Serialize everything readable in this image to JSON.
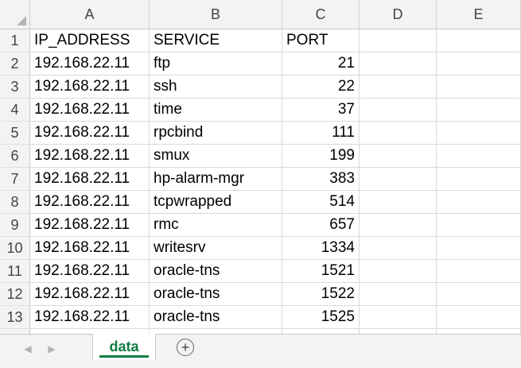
{
  "columns": [
    "A",
    "B",
    "C",
    "D",
    "E"
  ],
  "rows": [
    {
      "num": "1",
      "cells": [
        "IP_ADDRESS",
        "SERVICE",
        "PORT",
        "",
        ""
      ]
    },
    {
      "num": "2",
      "cells": [
        "192.168.22.11",
        "ftp",
        "21",
        "",
        ""
      ]
    },
    {
      "num": "3",
      "cells": [
        "192.168.22.11",
        "ssh",
        "22",
        "",
        ""
      ]
    },
    {
      "num": "4",
      "cells": [
        "192.168.22.11",
        "time",
        "37",
        "",
        ""
      ]
    },
    {
      "num": "5",
      "cells": [
        "192.168.22.11",
        "rpcbind",
        "111",
        "",
        ""
      ]
    },
    {
      "num": "6",
      "cells": [
        "192.168.22.11",
        "smux",
        "199",
        "",
        ""
      ]
    },
    {
      "num": "7",
      "cells": [
        "192.168.22.11",
        "hp-alarm-mgr",
        "383",
        "",
        ""
      ]
    },
    {
      "num": "8",
      "cells": [
        "192.168.22.11",
        "tcpwrapped",
        "514",
        "",
        ""
      ]
    },
    {
      "num": "9",
      "cells": [
        "192.168.22.11",
        "rmc",
        "657",
        "",
        ""
      ]
    },
    {
      "num": "10",
      "cells": [
        "192.168.22.11",
        "writesrv",
        "1334",
        "",
        ""
      ]
    },
    {
      "num": "11",
      "cells": [
        "192.168.22.11",
        "oracle-tns",
        "1521",
        "",
        ""
      ]
    },
    {
      "num": "12",
      "cells": [
        "192.168.22.11",
        "oracle-tns",
        "1522",
        "",
        ""
      ]
    },
    {
      "num": "13",
      "cells": [
        "192.168.22.11",
        "oracle-tns",
        "1525",
        "",
        ""
      ]
    }
  ],
  "tabs": {
    "active": "data",
    "add_label": "+",
    "prev_icon": "triangle-left-icon",
    "next_icon": "triangle-right-icon"
  },
  "colors": {
    "accent": "#107c41"
  }
}
